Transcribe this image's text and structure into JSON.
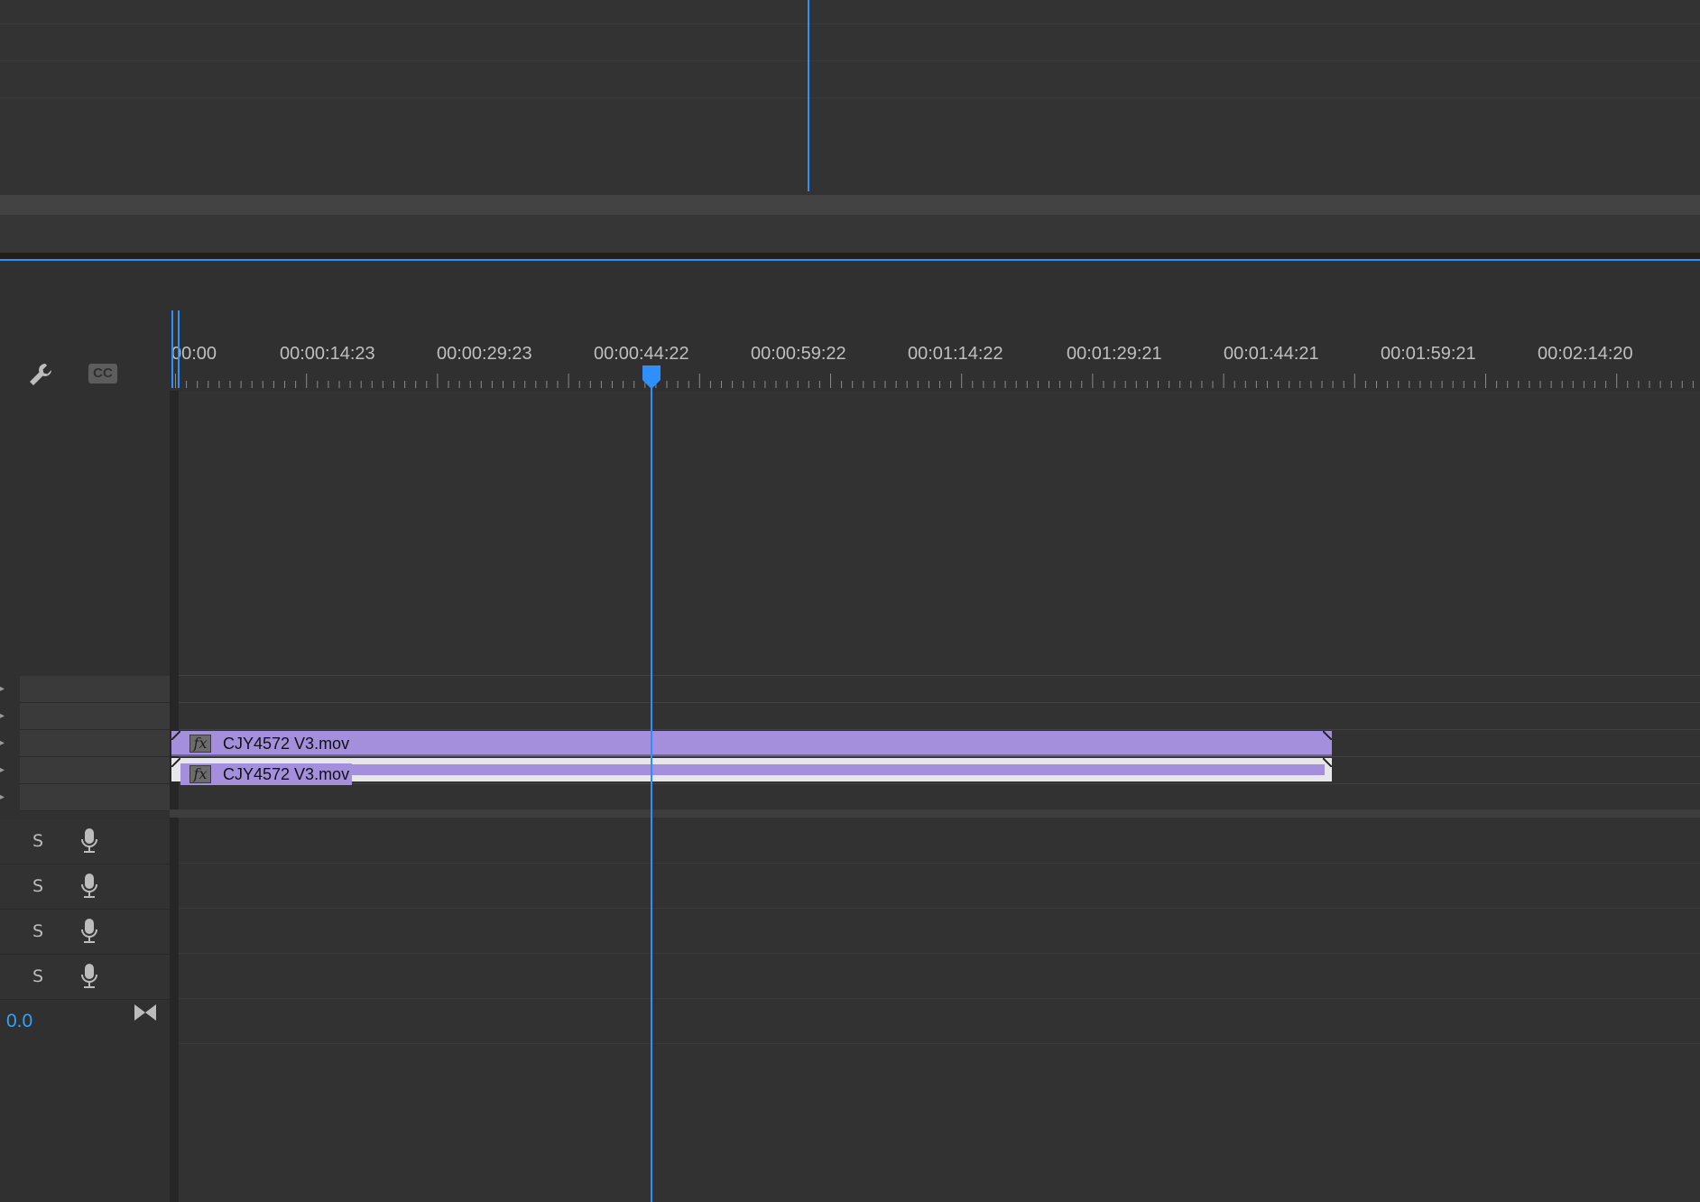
{
  "timeline": {
    "ruler_labels": [
      "00:00",
      "00:00:14:23",
      "00:00:29:23",
      "00:00:44:22",
      "00:00:59:22",
      "00:01:14:22",
      "00:01:29:21",
      "00:01:44:21",
      "00:01:59:21",
      "00:02:14:20"
    ],
    "current_time_label": "00:00:44:22",
    "tools": {
      "settings_icon": "wrench-icon",
      "captions_icon": "cc-icon",
      "captions_label": "CC"
    }
  },
  "clips": {
    "video": {
      "name": "CJY4572 V3.mov",
      "badge": "fx",
      "color": "#a48fdc"
    },
    "audio": {
      "name": "CJY4572 V3.mov",
      "badge": "fx",
      "color": "#a48fdc"
    }
  },
  "audio_tracks": [
    {
      "solo": "S",
      "mic": "microphone-icon"
    },
    {
      "solo": "S",
      "mic": "microphone-icon"
    },
    {
      "solo": "S",
      "mic": "microphone-icon"
    },
    {
      "solo": "S",
      "mic": "microphone-icon"
    }
  ],
  "master": {
    "value": "0.0",
    "icon": "bowtie-icon"
  },
  "colors": {
    "playhead": "#2e8fff",
    "clip": "#a48fdc",
    "background": "#323232"
  }
}
